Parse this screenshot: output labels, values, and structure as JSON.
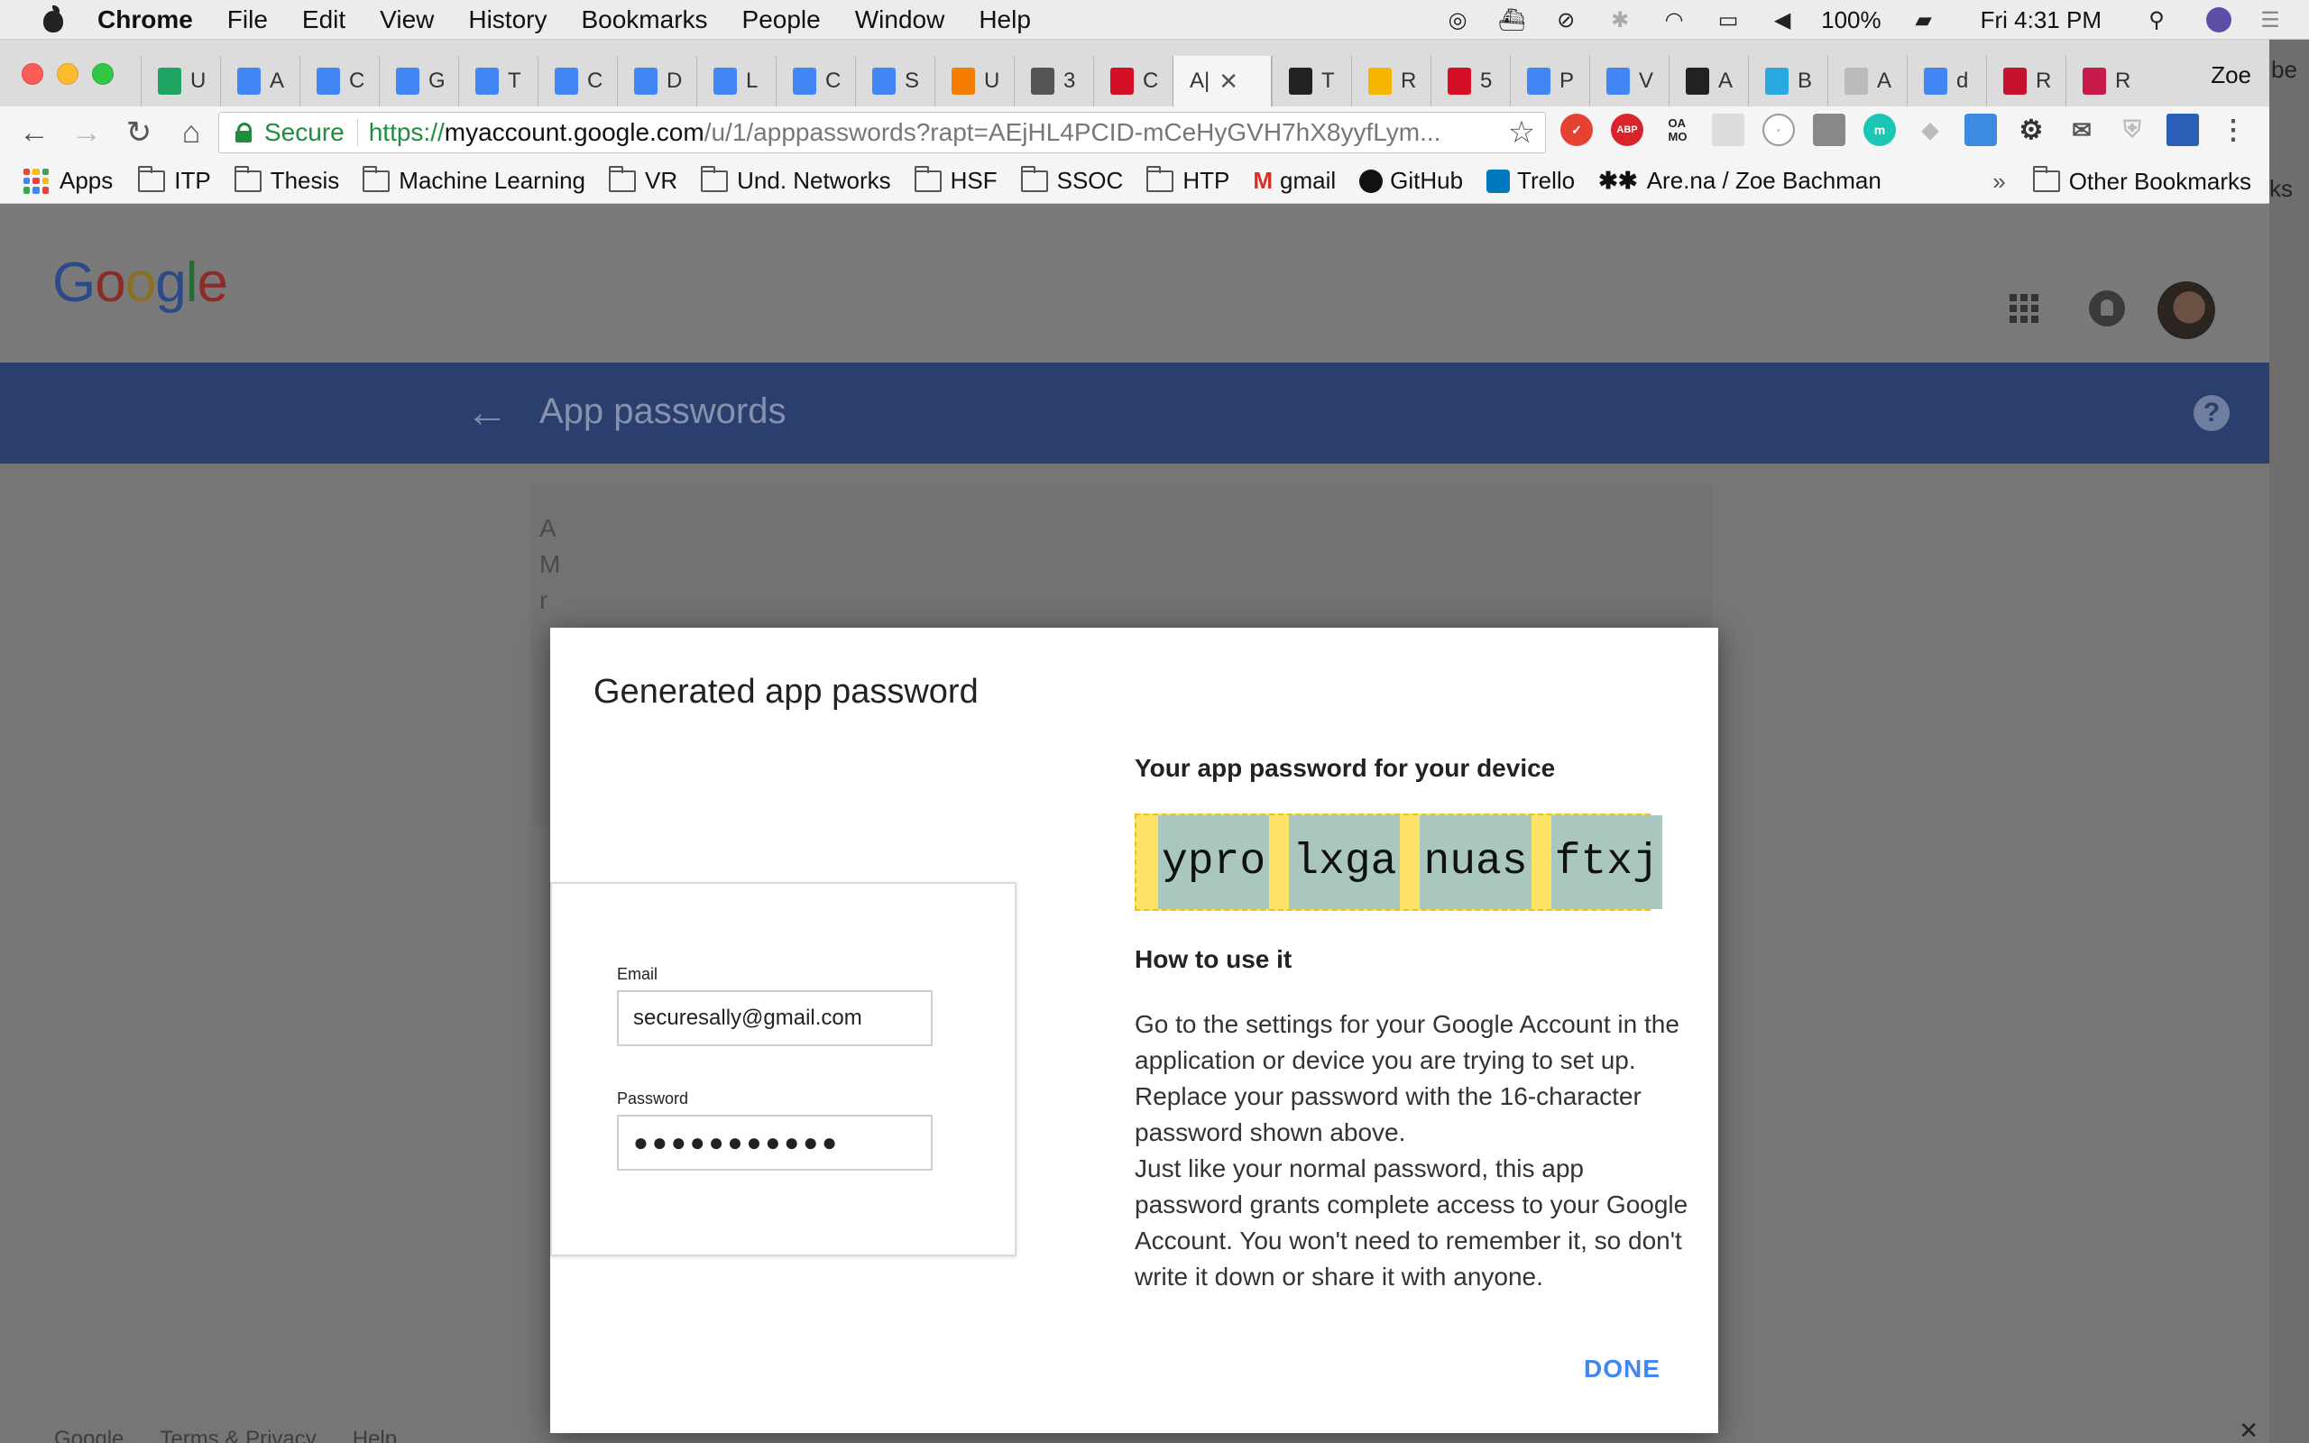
{
  "menubar": {
    "app": "Chrome",
    "items": [
      "File",
      "Edit",
      "View",
      "History",
      "Bookmarks",
      "People",
      "Window",
      "Help"
    ],
    "battery": "100%",
    "clock": "Fri 4:31 PM"
  },
  "browser": {
    "tabs": [
      {
        "letter": "U",
        "color": "#1fa463"
      },
      {
        "letter": "A",
        "color": "#4285f4"
      },
      {
        "letter": "C",
        "color": "#4285f4"
      },
      {
        "letter": "G",
        "color": "#4285f4"
      },
      {
        "letter": "T",
        "color": "#4285f4"
      },
      {
        "letter": "C",
        "color": "#4285f4"
      },
      {
        "letter": "D",
        "color": "#4285f4"
      },
      {
        "letter": "L",
        "color": "#4285f4"
      },
      {
        "letter": "C",
        "color": "#4285f4"
      },
      {
        "letter": "S",
        "color": "#4285f4"
      },
      {
        "letter": "U",
        "color": "#f57d00"
      },
      {
        "letter": "3",
        "color": "#555555"
      },
      {
        "letter": "C",
        "color": "#d50f25"
      }
    ],
    "active_tab": "A|",
    "tabs_after": [
      {
        "letter": "T",
        "color": "#222222"
      },
      {
        "letter": "R",
        "color": "#f4b400"
      },
      {
        "letter": "5",
        "color": "#d50f25"
      },
      {
        "letter": "P",
        "color": "#4285f4"
      },
      {
        "letter": "V",
        "color": "#4285f4"
      },
      {
        "letter": "A",
        "color": "#222222"
      },
      {
        "letter": "B",
        "color": "#29a8e0"
      },
      {
        "letter": "A",
        "color": "#bbbbbb"
      },
      {
        "letter": "d",
        "color": "#4285f4"
      },
      {
        "letter": "R",
        "color": "#c4122f"
      },
      {
        "letter": "R",
        "color": "#c51a4a"
      }
    ],
    "profile_name": "Zoe",
    "secure_label": "Secure",
    "url_scheme": "https://",
    "url_host": "myaccount.google.com",
    "url_rest": "/u/1/apppasswords?rapt=AEjHL4PCID-mCeHyGVH7hX8yyfLym...",
    "bookmarks": [
      "ITP",
      "Thesis",
      "Machine Learning",
      "VR",
      "Und. Networks",
      "HSF",
      "SSOC",
      "HTP"
    ],
    "bm_apps": "Apps",
    "bm_gmail": "gmail",
    "bm_github": "GitHub",
    "bm_trello": "Trello",
    "bm_arena": "Are.na / Zoe Bachman",
    "bm_other": "Other Bookmarks",
    "bm_chevron": "»"
  },
  "google": {
    "logo_letters": [
      "G",
      "o",
      "o",
      "g",
      "l",
      "e"
    ],
    "page_title": "App passwords",
    "bg_text_lines": [
      "A",
      "M",
      "r"
    ]
  },
  "dialog": {
    "title": "Generated app password",
    "preview_email_label": "Email",
    "preview_email_value": "securesally@gmail.com",
    "preview_password_label": "Password",
    "preview_password_dots": "●●●●●●●●●●●",
    "password_heading": "Your app password for your device",
    "password_chunks": [
      "ypro",
      "lxga",
      "nuas",
      "ftxj"
    ],
    "how_heading": "How to use it",
    "how_para1": "Go to the settings for your Google Account in the application or device you are trying to set up. Replace your password with the 16-character password shown above.",
    "how_para2": "Just like your normal password, this app password grants complete access to your Google Account. You won't need to remember it, so don't write it down or share it with anyone.",
    "done_label": "DONE"
  },
  "footer": {
    "links": [
      "Google",
      "Terms & Privacy",
      "Help"
    ]
  },
  "colors": {
    "google_blue_bar": "#2a3f6e",
    "password_highlight": "#fce265",
    "done_blue": "#4285f4",
    "secure_green": "#1e8e3e"
  }
}
